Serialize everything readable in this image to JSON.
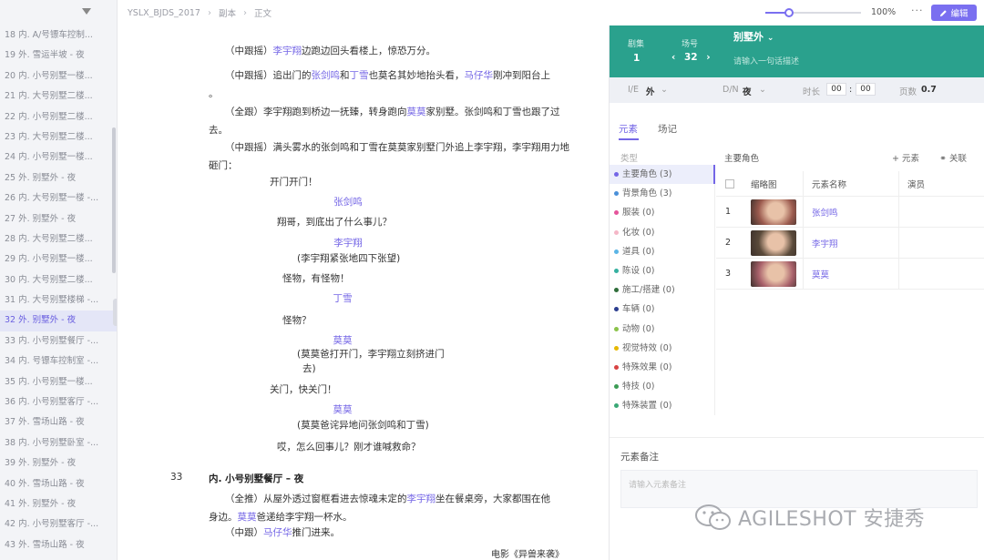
{
  "breadcrumb": {
    "project": "YSLX_BJDS_2017",
    "level1": "副本",
    "level2": "正文"
  },
  "toolbar": {
    "zoom": "100%",
    "zoom_level": 0.25,
    "more": "···",
    "edit_label": "编辑"
  },
  "scenes": [
    "18 内. A/号镖车控制...",
    "19 外. 雪运半坡 - 夜",
    "20 内. 小号别墅一楼...",
    "21 内. 大号别墅二楼...",
    "22 内. 小号别墅二楼...",
    "23 内. 大号别墅二楼...",
    "24 内. 小号别墅一楼...",
    "25 外. 别墅外 - 夜",
    "26 内. 大号别墅一楼 -...",
    "27 外. 别墅外 - 夜",
    "28 内. 大号别墅二楼...",
    "29 内. 小号别墅一楼...",
    "30 内. 大号别墅二楼...",
    "31 内. 大号别墅楼梯 -...",
    "32 外. 别墅外 - 夜",
    "33 内. 小号别墅餐厅 -...",
    "34 内. 号镖车控制室 -...",
    "35 内. 小号别墅一楼...",
    "36 内. 小号别墅客厅 -...",
    "37 外. 雪场山路 - 夜",
    "38 内. 小号别墅卧室 -...",
    "39 外. 别墅外 - 夜",
    "40 外. 雪场山路 - 夜",
    "41 外. 别墅外 - 夜",
    "42 内. 小号别墅客厅 -...",
    "43 外. 雪场山路 - 夜"
  ],
  "active_scene_index": 14,
  "script": {
    "p1_pre": "（中跟摇）",
    "p1_role": "李宇翔",
    "p1_post": "边跑边回头看楼上，惊恐万分。",
    "p2_pre": "（中跟摇）追出门的",
    "p2_role1": "张剑鸣",
    "p2_mid1": "和",
    "p2_role2": "丁雪",
    "p2_mid2": "也莫名其妙地抬头看，",
    "p2_role3": "马仔华",
    "p2_post": "刚冲到阳台上",
    "p2_tail": "。",
    "p3_pre": "（全跟）李宇翔跑到桥边一抚臻，转身跑向",
    "p3_role": "莫莫",
    "p3_post": "家别墅。张剑鸣和丁雪也跟了过去。",
    "p4": "（中跟摇）满头雾水的张剑鸣和丁雪在莫莫家别墅门外追上李宇翔，李宇翔用力地砸门：",
    "d1": "开门开门！",
    "c1": "张剑鸣",
    "d2": "翔哥，到底出了什么事儿？",
    "c2": "李宇翔",
    "x2": "(李宇翔紧张地四下张望)",
    "d3": "怪物，有怪物！",
    "c3": "丁雪",
    "d4": "怪物？",
    "c4": "莫莫",
    "x4a": "(莫莫爸打开门，李宇翔立刻挤进门",
    "x4b": "去)",
    "d5": "关门，快关门！",
    "c5": "莫莫",
    "x5": "(莫莫爸诧异地问张剑鸣和丁雪)",
    "d6": "哎，怎么回事儿？刚才谁喊救命？",
    "scene_no": "33",
    "scene_heading": "内. 小号别墅餐厅 – 夜",
    "p5_pre": "（全推）从屋外透过窗框看进去惊魂未定的",
    "p5_role1": "李宇翔",
    "p5_mid": "坐在餐桌旁，大家都围在他",
    "p5_mid2": "身边。",
    "p5_role2": "莫莫",
    "p5_post": "爸递给李宇翔一杯水。",
    "p6_pre": "（中跟）",
    "p6_role": "马仔华",
    "p6_post": "推门进来。",
    "footer": "电影《异兽来袭》"
  },
  "panel": {
    "episode_label": "剧集",
    "episode_value": "1",
    "scene_label": "场号",
    "scene_value": "32",
    "scene_prev": "‹",
    "scene_next": "›",
    "scene_name": "别墅外",
    "scene_hint": "请输入一句话描述",
    "ie_label": "I/E",
    "ie_value": "外",
    "dn_label": "D/N",
    "dn_value": "夜",
    "duration_label": "时长",
    "duration_min": "00",
    "duration_sep": ":",
    "duration_sec": "00",
    "pages_label": "页数",
    "pages_value": "0.7",
    "tabs": [
      "元素",
      "场记"
    ],
    "cat_header": "类型",
    "main_role_title": "主要角色",
    "add_label": "+ 元素",
    "link_label": "⚭ 关联",
    "table_headers": {
      "thumb": "缩略图",
      "name": "元素名称",
      "actor": "演员"
    },
    "notes_label": "元素备注",
    "notes_placeholder": "请输入元素备注"
  },
  "categories": [
    {
      "label": "主要角色 (3)",
      "color": "#7466e6"
    },
    {
      "label": "背景角色 (3)",
      "color": "#4a90d9"
    },
    {
      "label": "服装 (0)",
      "color": "#e5549b"
    },
    {
      "label": "化妆 (0)",
      "color": "#f5b7c7"
    },
    {
      "label": "道具 (0)",
      "color": "#5bb5e6"
    },
    {
      "label": "陈设 (0)",
      "color": "#35b0a0"
    },
    {
      "label": "施工/搭建 (0)",
      "color": "#2f6d3a"
    },
    {
      "label": "车辆 (0)",
      "color": "#2c3e8f"
    },
    {
      "label": "动物 (0)",
      "color": "#8bc34a"
    },
    {
      "label": "视觉特效 (0)",
      "color": "#e6b800"
    },
    {
      "label": "特殊效果 (0)",
      "color": "#d84343"
    },
    {
      "label": "特技 (0)",
      "color": "#3c9c54"
    },
    {
      "label": "特殊装置 (0)",
      "color": "#3aa876"
    }
  ],
  "elements": [
    {
      "index": "1",
      "name": "张剑鸣",
      "thumb_color": "#9b5a4e"
    },
    {
      "index": "2",
      "name": "李宇翔",
      "thumb_color": "#5a4a3a"
    },
    {
      "index": "3",
      "name": "莫莫",
      "thumb_color": "#a8606a"
    }
  ],
  "watermark": "AGILESHOT 安捷秀"
}
